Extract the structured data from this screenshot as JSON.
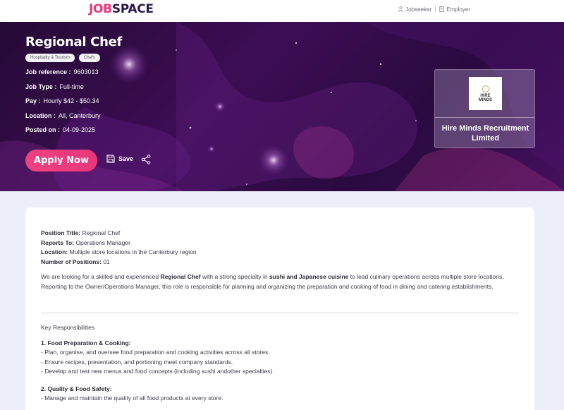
{
  "brand": {
    "logo_part1": "JOB",
    "logo_part2": "SPACE"
  },
  "topnav": {
    "jobseeker": "Jobseeker",
    "employer": "Employer"
  },
  "job": {
    "title": "Regional Chef",
    "tags": [
      "Hospitality & Tourism",
      "Chefs"
    ],
    "reference_label": "Job reference :",
    "reference": "9603013",
    "type_label": "Job Type :",
    "type": "Full-time",
    "pay_label": "Pay :",
    "pay": "Hourly $42 - $50.34",
    "location_label": "Location :",
    "location": "All, Canterbury",
    "posted_label": "Posted on :",
    "posted": "04-09-2025"
  },
  "actions": {
    "apply": "Apply Now",
    "save": "Save"
  },
  "company": {
    "logo_text_1": "HIRE",
    "logo_text_2": "MINDS",
    "name": "Hire Minds Recruitment Limited"
  },
  "description": {
    "position_label": "Position Title:",
    "position_value": "Regional Chef",
    "reports_label": "Reports To:",
    "reports_value": "Operations Manager",
    "location_label": "Location:",
    "location_value": "Multiple store locations in the Canterbury region",
    "positions_label": "Number of Positions:",
    "positions_value": "01",
    "intro_1": "We are looking for a skilled and experienced ",
    "intro_b1": "Regional Chef",
    "intro_2": " with a strong specialty in ",
    "intro_b2": "sushi and Japanese cuisine",
    "intro_3": " to lead culinary operations across multiple store locations. Reporting to the Owner/Operations Manager, this role is responsible for planning and organizing the preparation and cooking of food in dining and catering establishments.",
    "resp_heading": "Key Responsibilities",
    "section1_title": "1. Food Preparation & Cooking:",
    "section1_items": [
      "- Plan, organise, and oversee food preparation and cooking activities across all stores.",
      "- Ensure recipes, presentation, and portioning meet company standards.",
      "- Develop and test new menus and food concepts (including sushi andother specialties)."
    ],
    "section2_title": "2. Quality & Food Safety:",
    "section2_first": "- Manage and maintain the quality of all food products at every store."
  },
  "colors": {
    "accent": "#e8367c",
    "hero_bg": "#3d0d54",
    "brand_dark": "#2a1a4a"
  }
}
